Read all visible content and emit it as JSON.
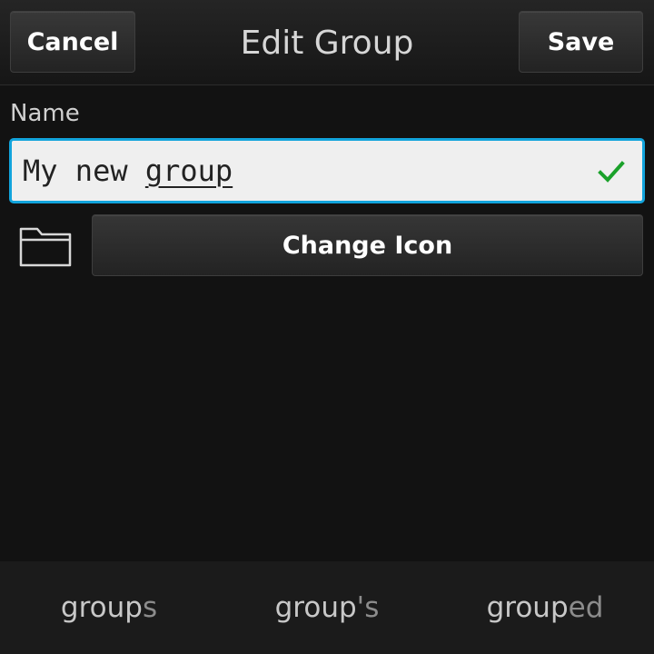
{
  "titlebar": {
    "cancel_label": "Cancel",
    "title": "Edit Group",
    "save_label": "Save"
  },
  "form": {
    "name_label": "Name",
    "name_value_prefix": "My new ",
    "name_value_current_word": "group",
    "name_valid_icon": "checkmark-icon",
    "group_icon": "folder-icon",
    "change_icon_label": "Change Icon"
  },
  "suggestions": [
    {
      "stem": "group",
      "rest": "s"
    },
    {
      "stem": "group",
      "rest": "'s"
    },
    {
      "stem": "group",
      "rest": "ed"
    }
  ],
  "colors": {
    "accent_focus": "#12a4dc",
    "valid_check": "#1aa12a",
    "background": "#121212"
  }
}
